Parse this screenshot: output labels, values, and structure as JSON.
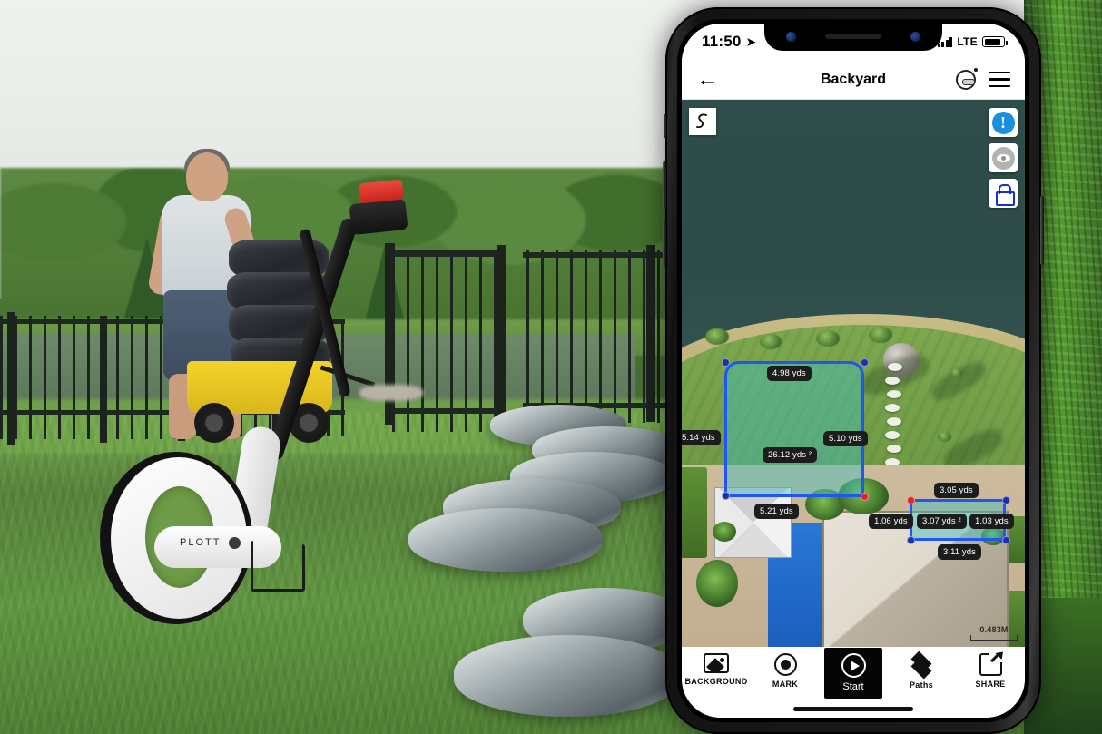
{
  "scene": {
    "description": "Outdoor landscaping photo with man, wagon of mulch bags and a PLOTT measuring wheel, overlaid with a smartphone showing the PLOTT app",
    "device_brand": "PLOTT"
  },
  "phone": {
    "status_bar": {
      "time": "11:50",
      "location_arrow": "location-arrow-icon",
      "signal": "signal-bars-icon",
      "network": "LTE",
      "battery": "battery-icon"
    },
    "nav_bar": {
      "back": "back-arrow-icon",
      "title": "Backyard",
      "wheel_icon": "measuring-wheel-icon",
      "menu_icon": "hamburger-menu-icon"
    },
    "map": {
      "tool_badge": "squiggle-path-icon",
      "fabs": [
        {
          "name": "info-alert-button",
          "icon": "exclamation-circle-icon",
          "color": "#1a8fe0"
        },
        {
          "name": "visibility-button",
          "icon": "eye-icon",
          "color": "#b3b3b3"
        },
        {
          "name": "lock-button",
          "icon": "lock-icon",
          "color": "#1b2fd0"
        }
      ],
      "scale": "0.483M",
      "shapes": [
        {
          "name": "large-plot",
          "area": "26.12 yds ²",
          "edges": {
            "top": "4.98 yds",
            "right": "5.10 yds",
            "left": "5.14 yds",
            "bottom": "5.21 yds"
          }
        },
        {
          "name": "small-plot",
          "area": "3.07 yds ²",
          "edges": {
            "top": "3.05 yds",
            "right": "1.03 yds",
            "left": "1.06 yds",
            "bottom": "3.11 yds"
          }
        }
      ]
    },
    "tabbar": [
      {
        "label": "BACKGROUND",
        "icon": "image-icon",
        "active": false
      },
      {
        "label": "MARK",
        "icon": "target-dot-icon",
        "active": false
      },
      {
        "label": "Start",
        "icon": "play-circle-icon",
        "active": true
      },
      {
        "label": "Paths",
        "icon": "layers-diamond-icon",
        "active": false
      },
      {
        "label": "SHARE",
        "icon": "share-arrow-icon",
        "active": false
      }
    ]
  }
}
